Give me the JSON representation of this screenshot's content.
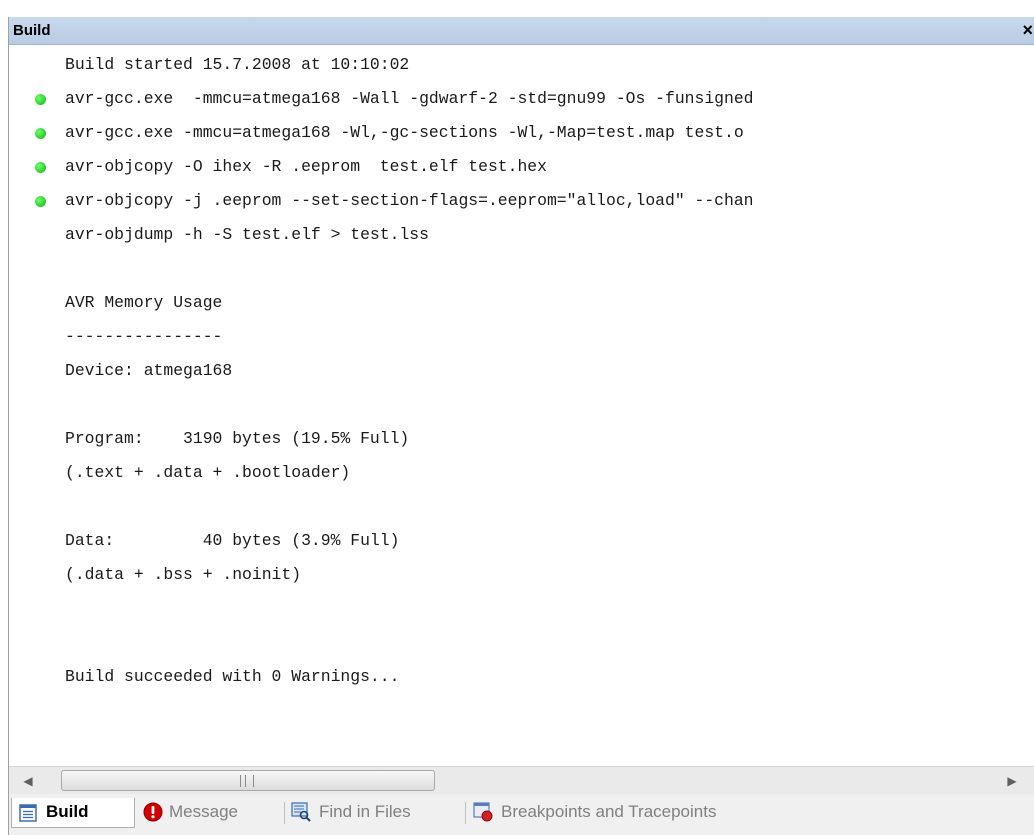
{
  "window": {
    "title": "Build",
    "close_label": "×"
  },
  "output": {
    "lines": [
      {
        "text": "Build started 15.7.2008 at 10:10:02",
        "status": false
      },
      {
        "text": "avr-gcc.exe  -mmcu=atmega168 -Wall -gdwarf-2 -std=gnu99 -Os -funsigned",
        "status": true
      },
      {
        "text": "avr-gcc.exe -mmcu=atmega168 -Wl,-gc-sections -Wl,-Map=test.map test.o",
        "status": true
      },
      {
        "text": "avr-objcopy -O ihex -R .eeprom  test.elf test.hex",
        "status": true
      },
      {
        "text": "avr-objcopy -j .eeprom --set-section-flags=.eeprom=\"alloc,load\" --chan",
        "status": true
      },
      {
        "text": "avr-objdump -h -S test.elf > test.lss",
        "status": false
      },
      {
        "text": "",
        "status": false
      },
      {
        "text": "AVR Memory Usage",
        "status": false
      },
      {
        "text": "----------------",
        "status": false
      },
      {
        "text": "Device: atmega168",
        "status": false
      },
      {
        "text": "",
        "status": false
      },
      {
        "text": "Program:    3190 bytes (19.5% Full)",
        "status": false
      },
      {
        "text": "(.text + .data + .bootloader)",
        "status": false
      },
      {
        "text": "",
        "status": false
      },
      {
        "text": "Data:         40 bytes (3.9% Full)",
        "status": false
      },
      {
        "text": "(.data + .bss + .noinit)",
        "status": false
      },
      {
        "text": "",
        "status": false
      },
      {
        "text": "",
        "status": false
      },
      {
        "text": "Build succeeded with 0 Warnings...",
        "status": false
      }
    ],
    "status_color": "#22cc22"
  },
  "scrollbar": {
    "left_arrow": "◀",
    "right_arrow": "▶"
  },
  "tabs": [
    {
      "label": "Build",
      "icon": "build-output-icon",
      "active": true
    },
    {
      "label": "Message",
      "icon": "error-message-icon",
      "active": false
    },
    {
      "label": "Find in Files",
      "icon": "find-in-files-icon",
      "active": false
    },
    {
      "label": "Breakpoints and Tracepoints",
      "icon": "breakpoint-icon",
      "active": false
    }
  ]
}
